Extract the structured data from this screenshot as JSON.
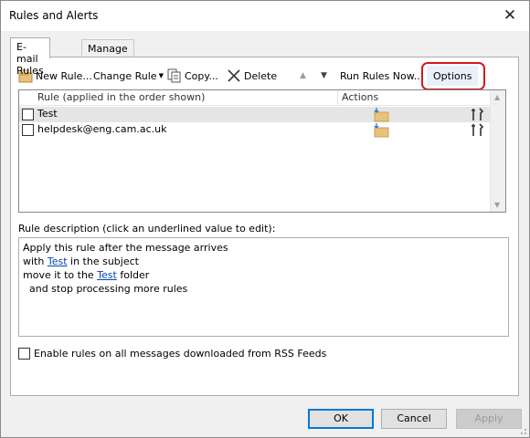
{
  "window": {
    "title": "Rules and Alerts",
    "close_glyph": "✕"
  },
  "tabs": [
    {
      "label": "E-mail Rules",
      "active": true
    },
    {
      "label": "Manage Alerts",
      "active": false
    }
  ],
  "toolbar": {
    "new_rule": "New Rule...",
    "change_rule": "Change Rule",
    "copy": "Copy...",
    "delete": "Delete",
    "run_rules": "Run Rules Now...",
    "options": "Options",
    "move_up_glyph": "▲",
    "move_down_glyph": "▼",
    "dropdown_glyph": "▼"
  },
  "rules_list": {
    "columns": [
      "Rule (applied in the order shown)",
      "Actions"
    ],
    "rows": [
      {
        "name": "Test",
        "enabled": false,
        "selected": true
      },
      {
        "name": "helpdesk@eng.cam.ac.uk",
        "enabled": false,
        "selected": false
      }
    ]
  },
  "description": {
    "label": "Rule description (click an underlined value to edit):",
    "line1": "Apply this rule after the message arrives",
    "line2_pre": "with ",
    "line2_link": "Test",
    "line2_post": " in the subject",
    "line3_pre": "move it to the ",
    "line3_link": "Test",
    "line3_post": " folder",
    "line4": "  and stop processing more rules"
  },
  "rss_option": {
    "label": "Enable rules on all messages downloaded from RSS Feeds",
    "checked": false
  },
  "buttons": {
    "ok": "OK",
    "cancel": "Cancel",
    "apply": "Apply"
  },
  "colors": {
    "highlight_ring": "#d21a1a",
    "link": "#0645ad",
    "accent": "#0078d7"
  }
}
